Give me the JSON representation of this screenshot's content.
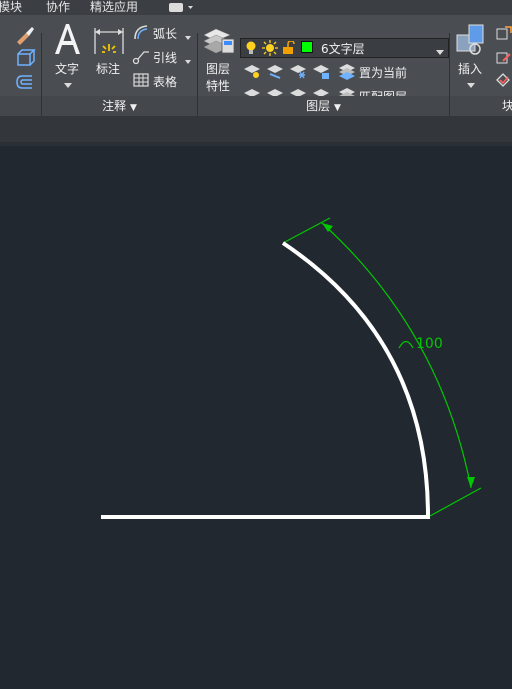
{
  "menubar": {
    "items": [
      "模块",
      "协作",
      "精选应用"
    ]
  },
  "annotate": {
    "text_label": "文字",
    "dim_label": "标注",
    "arc_label": "弧长",
    "leader_label": "引线",
    "table_label": "表格",
    "panel_title": "注释"
  },
  "layers": {
    "props_label_1": "图层",
    "props_label_2": "特性",
    "current_layer": "6文字层",
    "set_current": "置为当前",
    "match_layer": "匹配图层",
    "panel_title": "图层",
    "layer_color": "#00ff00"
  },
  "block": {
    "insert_label": "插入",
    "panel_title": "块"
  },
  "drawing": {
    "dimension_text": "100",
    "dim_color": "#00c800"
  }
}
